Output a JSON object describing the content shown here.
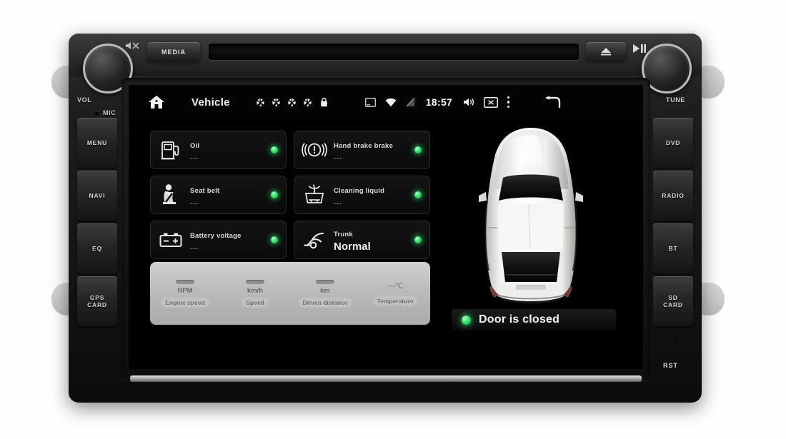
{
  "device": {
    "brand_icon": "mute-logo-icon",
    "knobs": [
      {
        "name": "volume-knob",
        "label": "VOL"
      },
      {
        "name": "tune-knob",
        "label": "TUNE"
      }
    ],
    "mic_label": "MIC",
    "media_button": "MEDIA",
    "eject_button_icon": "eject-icon",
    "playpause_icon": "play-pause-icon",
    "left_buttons": [
      "MENU",
      "NAVI",
      "EQ",
      "GPS\nCARD"
    ],
    "left_buttons_display": [
      {
        "label": "MENU",
        "name": "menu-button"
      },
      {
        "label": "NAVI",
        "name": "navi-button"
      },
      {
        "label": "EQ",
        "name": "eq-button"
      },
      {
        "label": "GPS CARD",
        "line1": "GPS",
        "line2": "CARD",
        "name": "gps-card-button"
      }
    ],
    "right_buttons_display": [
      {
        "label": "DVD",
        "name": "dvd-button"
      },
      {
        "label": "RADIO",
        "name": "radio-button"
      },
      {
        "label": "BT",
        "name": "bt-button"
      },
      {
        "label": "SD CARD",
        "line1": "SD",
        "line2": "CARD",
        "name": "sd-card-button"
      }
    ],
    "reset_label": "RST"
  },
  "statusbar": {
    "home_icon": "home-icon",
    "title": "Vehicle",
    "gear_icons": [
      "gear-icon",
      "gear-icon",
      "gear-icon",
      "gear-icon"
    ],
    "lock_icon": "lock-icon",
    "cast_icon": "cast-icon",
    "wifi_icon": "wifi-icon",
    "signal_off_icon": "signal-off-icon",
    "time": "18:57",
    "volume_icon": "speaker-icon",
    "screen_off_icon": "screen-off-icon",
    "overflow_icon": "more-vertical-icon",
    "back_icon": "back-arrow-icon"
  },
  "cards": [
    {
      "id": "oil",
      "icon": "fuel-pump-icon",
      "label": "Oil",
      "value": "---",
      "value_big": false,
      "status_color": "#2ee06a"
    },
    {
      "id": "handbrake",
      "icon": "brake-warning-icon",
      "label": "Hand brake brake",
      "value": "---",
      "value_big": false,
      "status_color": "#2ee06a"
    },
    {
      "id": "seatbelt",
      "icon": "seat-belt-icon",
      "label": "Seat belt",
      "value": "---",
      "value_big": false,
      "status_color": "#2ee06a"
    },
    {
      "id": "cleaning",
      "icon": "washer-fluid-icon",
      "label": "Cleaning liquid",
      "value": "---",
      "value_big": false,
      "status_color": "#2ee06a"
    },
    {
      "id": "battery",
      "icon": "battery-icon",
      "label": "Battery voltage",
      "value": "---",
      "value_big": false,
      "status_color": "#2ee06a"
    },
    {
      "id": "trunk",
      "icon": "trunk-open-icon",
      "label": "Trunk",
      "value": "Normal",
      "value_big": true,
      "status_color": "#2ee06a"
    }
  ],
  "metrics": [
    {
      "id": "engine-speed",
      "value": "---",
      "unit": "RPM",
      "name": "Engine speed"
    },
    {
      "id": "speed",
      "value": "---",
      "unit": "km/h",
      "name": "Speed"
    },
    {
      "id": "driven-distance",
      "value": "---",
      "unit": "km",
      "name": "Driven distance"
    },
    {
      "id": "temperature",
      "value": "—℃",
      "unit": "",
      "name": "Temperature"
    }
  ],
  "car": {
    "illustration": "top-down-car-icon",
    "body_color": "#f2f2f0"
  },
  "door_status": {
    "text": "Door is closed",
    "indicator_color": "#2ee06a"
  }
}
